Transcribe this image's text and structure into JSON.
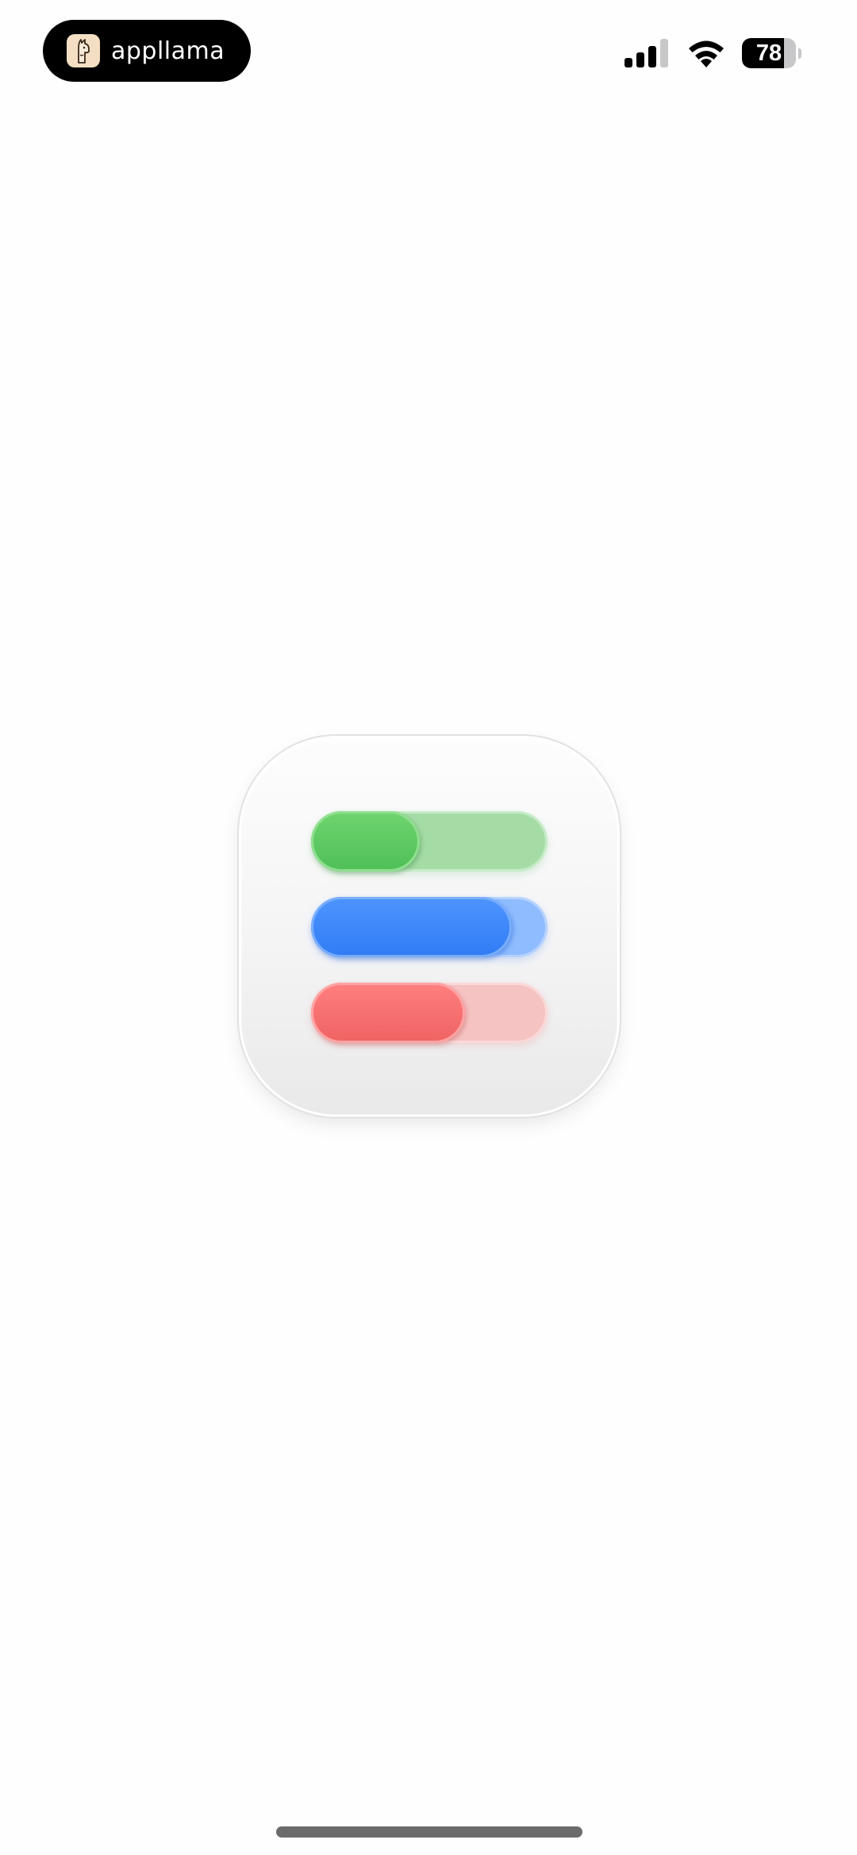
{
  "status_bar": {
    "app_name": "appllama",
    "battery_percent": "78",
    "battery_level": 0.78,
    "signal_bars_active": 3,
    "signal_bars_total": 4,
    "logo_icon": "llama-icon"
  },
  "app_icon": {
    "name": "toggle-switches-app-icon",
    "toggles": [
      {
        "color": "#4fbf57",
        "track_color": "#a5dca6",
        "knob_fraction": 0.46
      },
      {
        "color": "#2f7cf4",
        "track_color": "#8fbcff",
        "knob_fraction": 0.85
      },
      {
        "color": "#ef6363",
        "track_color": "#f6c3c3",
        "knob_fraction": 0.65
      }
    ]
  }
}
